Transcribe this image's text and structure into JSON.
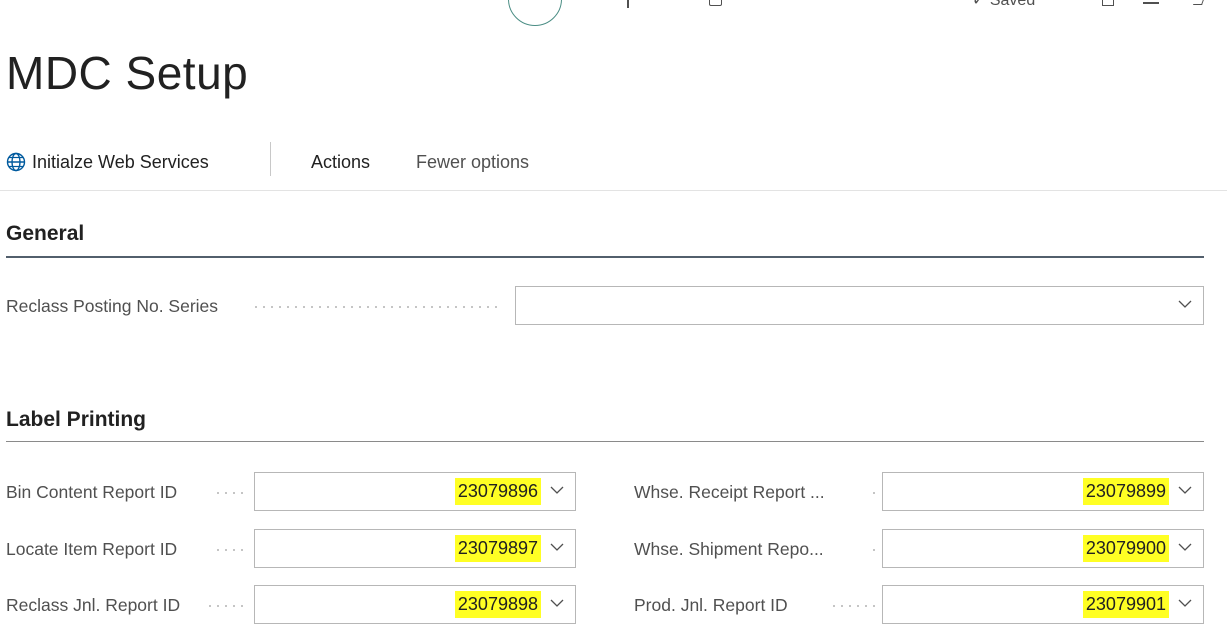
{
  "header": {
    "saved_status": "✓ Saved"
  },
  "page": {
    "title": "MDC Setup"
  },
  "action_bar": {
    "init_label": "Initialze Web Services",
    "actions_label": "Actions",
    "fewer_label": "Fewer options"
  },
  "general": {
    "title": "General",
    "reclass_series": {
      "label": "Reclass Posting No. Series",
      "value": ""
    }
  },
  "label_printing": {
    "title": "Label Printing",
    "bin_content": {
      "label": "Bin Content Report ID",
      "value": "23079896"
    },
    "locate_item": {
      "label": "Locate Item Report ID",
      "value": "23079897"
    },
    "reclass_jnl": {
      "label": "Reclass Jnl. Report ID",
      "value": "23079898"
    },
    "whse_receipt": {
      "label": "Whse. Receipt Report ...",
      "value": "23079899"
    },
    "whse_shipment": {
      "label": "Whse. Shipment Repo...",
      "value": "23079900"
    },
    "prod_jnl": {
      "label": "Prod. Jnl. Report ID",
      "value": "23079901"
    }
  },
  "colors": {
    "highlight": "#ffff24",
    "accent": "#4a8d84"
  },
  "icons": [
    "globe-icon",
    "chevron-down-icon",
    "bookmark-icon",
    "calendar-icon",
    "expand-icon"
  ]
}
